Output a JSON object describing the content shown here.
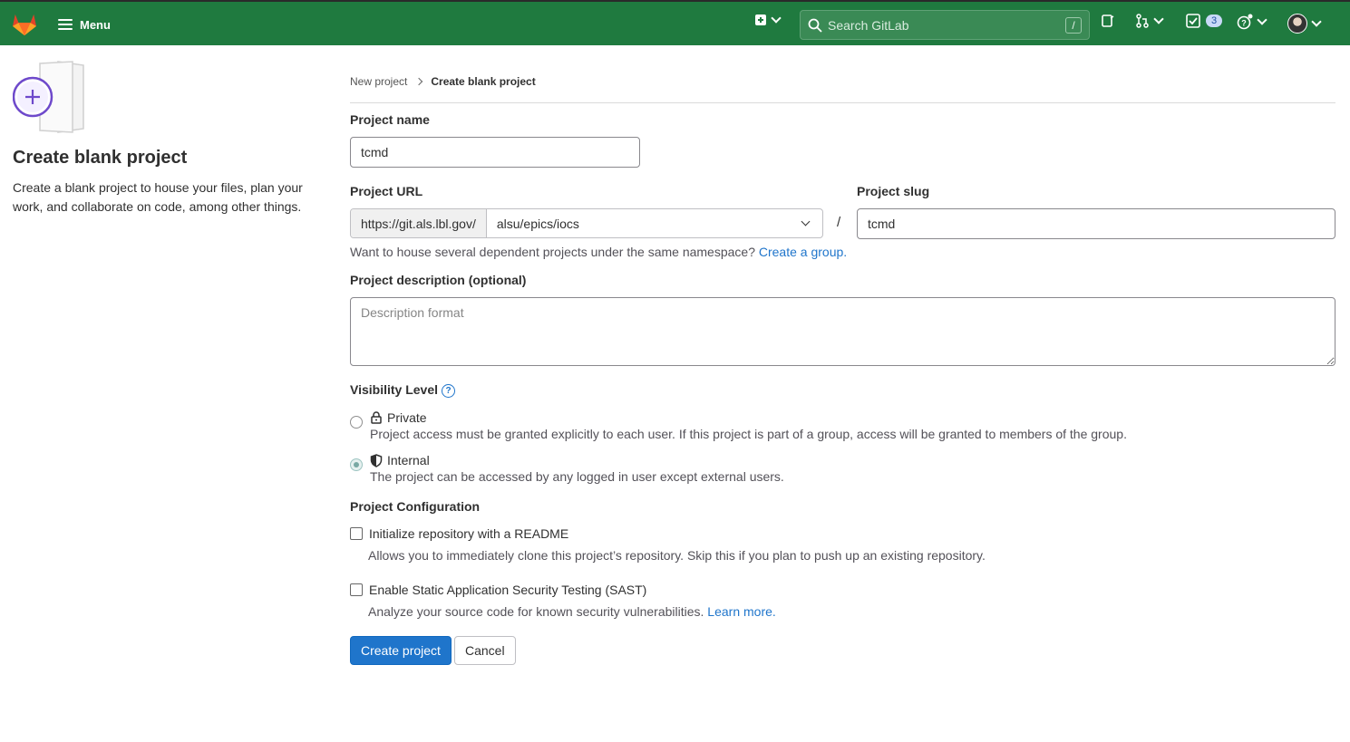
{
  "navbar": {
    "menu_label": "Menu",
    "search_placeholder": "Search GitLab",
    "search_shortcut": "/",
    "todo_count": "3",
    "colors": {
      "bar": "#1f7a3f",
      "brand": "#fc6d26"
    }
  },
  "left_panel": {
    "title": "Create blank project",
    "description": "Create a blank project to house your files, plan your work, and collaborate on code, among other things."
  },
  "breadcrumb": {
    "parent": "New project",
    "current": "Create blank project"
  },
  "form": {
    "project_name_label": "Project name",
    "project_name_value": "tcmd",
    "project_url_label": "Project URL",
    "url_prefix": "https://git.als.lbl.gov/",
    "namespace": "alsu/epics/iocs",
    "slash": "/",
    "project_slug_label": "Project slug",
    "project_slug_value": "tcmd",
    "namespace_help": "Want to house several dependent projects under the same namespace?",
    "create_group_link": "Create a group.",
    "description_label": "Project description (optional)",
    "description_placeholder": "Description format",
    "visibility_label": "Visibility Level",
    "visibility_options": [
      {
        "label": "Private",
        "description": "Project access must be granted explicitly to each user. If this project is part of a group, access will be granted to members of the group.",
        "checked": false
      },
      {
        "label": "Internal",
        "description": "The project can be accessed by any logged in user except external users.",
        "checked": true
      }
    ],
    "config_label": "Project Configuration",
    "readme_label": "Initialize repository with a README",
    "readme_help": "Allows you to immediately clone this project’s repository. Skip this if you plan to push up an existing repository.",
    "sast_label": "Enable Static Application Security Testing (SAST)",
    "sast_help": "Analyze your source code for known security vulnerabilities.",
    "learn_more": "Learn more.",
    "create_button": "Create project",
    "cancel_button": "Cancel"
  }
}
